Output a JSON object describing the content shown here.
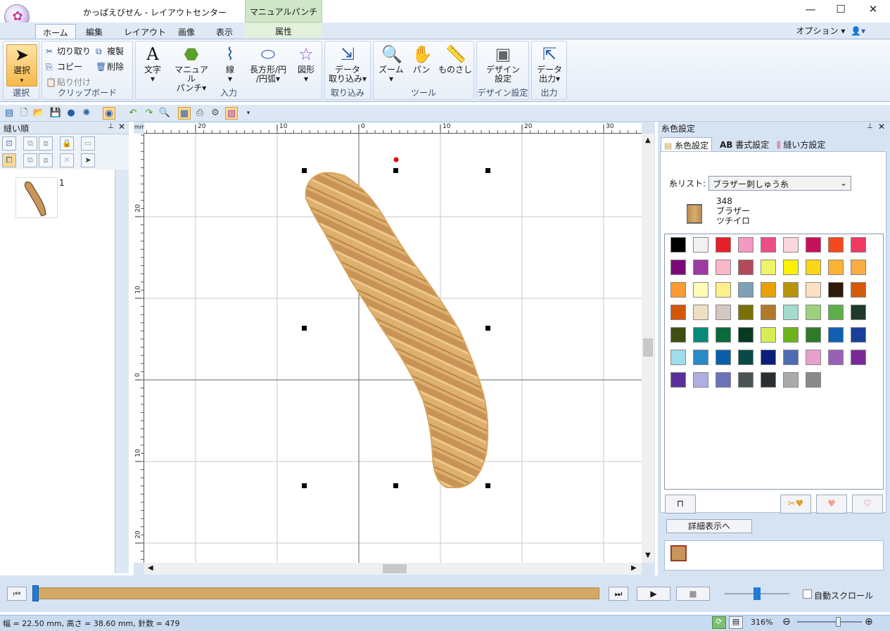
{
  "window": {
    "title": "かっぱえびせん - レイアウトセンター",
    "contextual_tab_header": "マニュアルパンチ",
    "contextual_tab": "属性",
    "minimize": "—",
    "maximize": "☐",
    "close": "✕"
  },
  "tabs": [
    "ホーム",
    "編集",
    "レイアウト",
    "画像",
    "表示"
  ],
  "options": {
    "label": "オプション"
  },
  "ribbon": {
    "select": {
      "button": "選択",
      "group": "選択"
    },
    "clipboard": {
      "cut": "切り取り",
      "duplicate": "複製",
      "copy": "コピー",
      "delete": "削除",
      "paste": "貼り付け",
      "group": "クリップボード"
    },
    "input": {
      "text": "文字",
      "manual_punch": "マニュアル",
      "manual_punch2": "パンチ",
      "line": "線",
      "rect": "長方形/円",
      "rect2": "/円弧",
      "shape": "図形",
      "group": "入力"
    },
    "import": {
      "data_import": "データ",
      "data_import2": "取り込み",
      "group": "取り込み"
    },
    "tools": {
      "zoom": "ズーム",
      "pan": "パン",
      "ruler": "ものさし",
      "group": "ツール"
    },
    "design": {
      "design_settings": "デザイン",
      "design_settings2": "設定",
      "group": "デザイン設定"
    },
    "output": {
      "data_output": "データ",
      "data_output2": "出力",
      "group": "出力"
    }
  },
  "left_panel": {
    "title": "縫い順",
    "items": [
      {
        "number": "1"
      }
    ]
  },
  "rulers": {
    "unit": "mm",
    "horizontal": [
      "20",
      "10",
      "0",
      "10",
      "20",
      "30"
    ],
    "vertical": [
      "20",
      "10",
      "0",
      "10",
      "20"
    ]
  },
  "right_panel": {
    "title": "糸色設定",
    "tabs": [
      "糸色設定",
      "書式設定",
      "縫い方設定"
    ],
    "format_tab_prefix": "AB",
    "thread_list_label": "糸リスト:",
    "thread_list_value": "ブラザー刺しゅう糸",
    "thread": {
      "code": "348",
      "brand": "ブラザー",
      "name": "ツチイロ",
      "color": "#c8955a"
    },
    "palette": [
      [
        "#000000",
        "#f2f2f2",
        "#e8202a",
        "#f49ac0",
        "#ee4c86",
        "#fcd6de",
        "#c8105a",
        "#f44a1a",
        "#f03a62"
      ],
      [
        "#7a0a7a",
        "#9c3aa0",
        "#f8b8c8",
        "#b24a5a",
        "#eef468",
        "#fff200",
        "#fcd418",
        "#fcb234",
        "#fcac42"
      ],
      [
        "#fc9a34",
        "#fefcb8",
        "#fcf08a",
        "#80a0b8",
        "#e8a208",
        "#b8940a",
        "#fee0c4",
        "#2e1a08",
        "#d45a0a"
      ],
      [
        "#d45608",
        "#ede0c2",
        "#d4c8c2",
        "#7a7208",
        "#b07a2a",
        "#a2dccc",
        "#9cd07c",
        "#5cb04a",
        "#1e3a2a"
      ],
      [
        "#3e4e10",
        "#0a8a7a",
        "#0a6a3a",
        "#083a22",
        "#d8ec54",
        "#6cb41e",
        "#2e7a28",
        "#1060b2",
        "#18409a"
      ],
      [
        "#a0dcec",
        "#2a8ac8",
        "#0a5eaa",
        "#0a4a46",
        "#0a1e7a",
        "#4e6cb2",
        "#e8a0cc",
        "#9a60b8",
        "#7a2a98"
      ],
      [
        "#5a3098",
        "#b0aede",
        "#6a72b8",
        "#4c5458",
        "#2a2e30",
        "#a8aaac",
        "#888a8c"
      ]
    ],
    "detail_button": "詳細表示へ"
  },
  "player": {
    "progress": 1.0,
    "speed_level": 0.5,
    "auto_scroll_label": "自動スクロール",
    "auto_scroll_checked": false
  },
  "status": {
    "text": "幅 = 22.50 mm, 高さ = 38.60 mm, 針数 = 479",
    "zoom": "316%",
    "zoom_level": 0.6
  }
}
